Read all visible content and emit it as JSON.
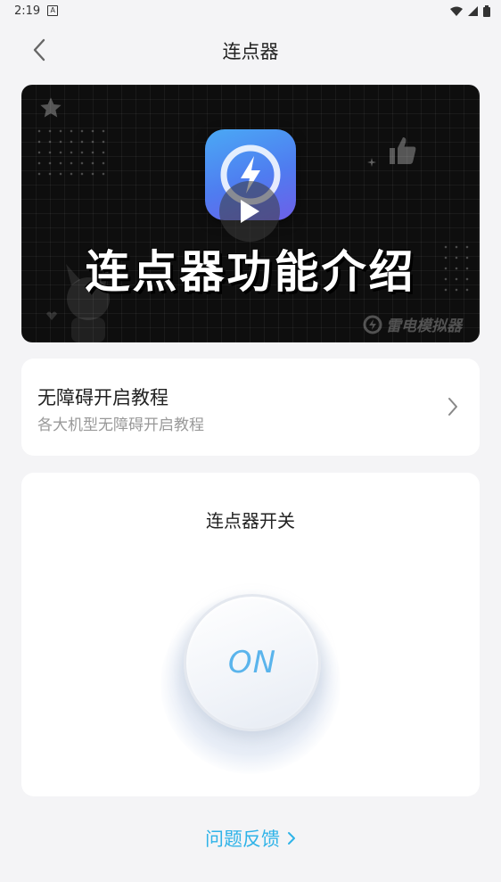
{
  "status_bar": {
    "time": "2:19",
    "notification_icon_text": "A",
    "icons": [
      "wifi-icon",
      "cellular-icon",
      "battery-icon"
    ]
  },
  "nav": {
    "title": "连点器",
    "back_icon": "chevron-left-icon"
  },
  "video": {
    "title_overlay": "连点器功能介绍",
    "brand_watermark": "雷电模拟器",
    "play_icon": "play-icon"
  },
  "tutorial": {
    "title": "无障碍开启教程",
    "subtitle": "各大机型无障碍开启教程",
    "chevron_icon": "chevron-right-icon"
  },
  "switch": {
    "title": "连点器开关",
    "button_label": "ON",
    "accent_color": "#5ab4ec"
  },
  "footer": {
    "feedback_label": "问题反馈",
    "feedback_color": "#2fb3e8"
  }
}
